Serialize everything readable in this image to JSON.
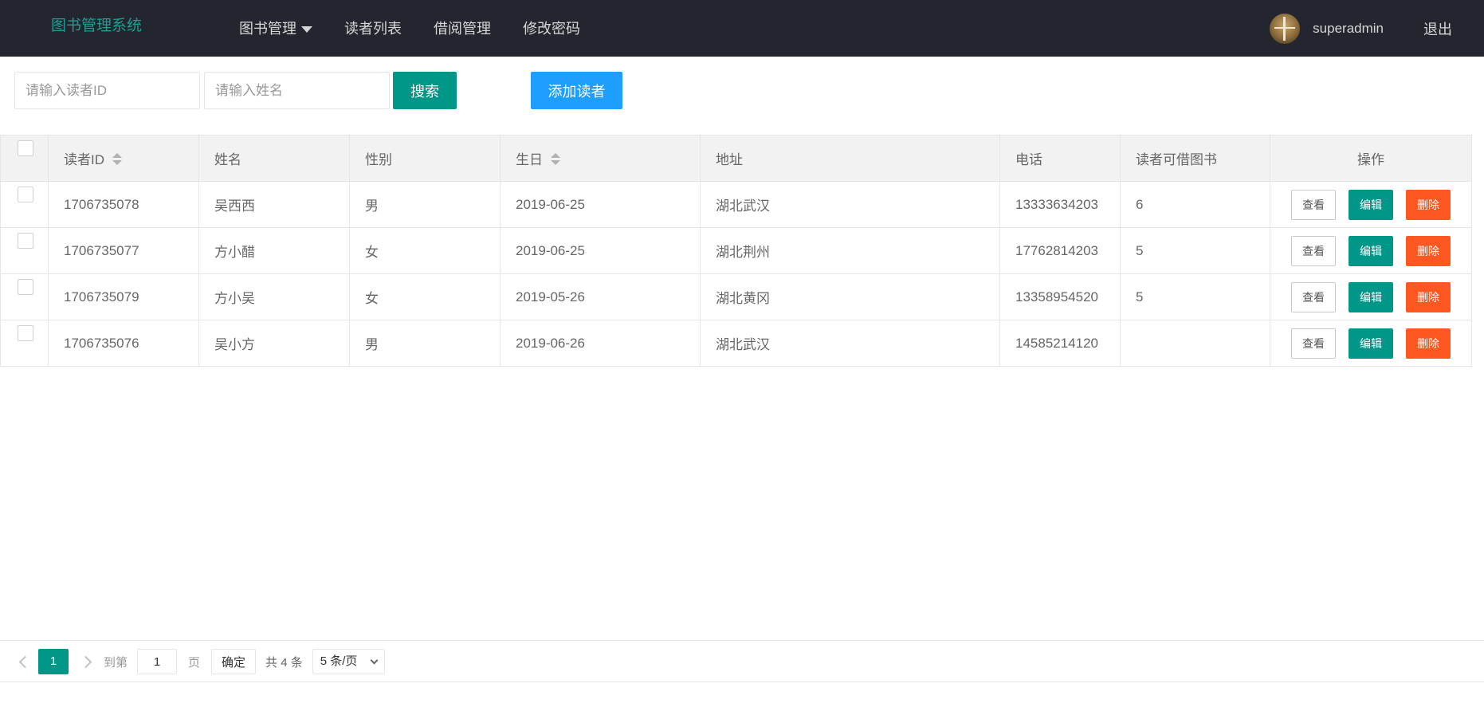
{
  "header": {
    "logo": "图书管理系统",
    "nav": [
      {
        "label": "图书管理",
        "has_dropdown": true,
        "icon": "caret-down-icon"
      },
      {
        "label": "读者列表"
      },
      {
        "label": "借阅管理"
      },
      {
        "label": "修改密码"
      }
    ],
    "username": "superadmin",
    "logout": "退出"
  },
  "toolbar": {
    "reader_id_placeholder": "请输入读者ID",
    "name_placeholder": "请输入姓名",
    "search_label": "搜索",
    "add_label": "添加读者"
  },
  "table": {
    "columns": [
      "读者ID",
      "姓名",
      "性别",
      "生日",
      "地址",
      "电话",
      "读者可借图书",
      "操作"
    ],
    "sortable": [
      "读者ID",
      "生日"
    ],
    "rows": [
      {
        "id": "1706735078",
        "name": "吴西西",
        "gender": "男",
        "birthday": "2019-06-25",
        "address": "湖北武汉",
        "phone": "13333634203",
        "quota": "6"
      },
      {
        "id": "1706735077",
        "name": "方小醋",
        "gender": "女",
        "birthday": "2019-06-25",
        "address": "湖北荆州",
        "phone": "17762814203",
        "quota": "5"
      },
      {
        "id": "1706735079",
        "name": "方小吴",
        "gender": "女",
        "birthday": "2019-05-26",
        "address": "湖北黄冈",
        "phone": "13358954520",
        "quota": "5"
      },
      {
        "id": "1706735076",
        "name": "吴小方",
        "gender": "男",
        "birthday": "2019-06-26",
        "address": "湖北武汉",
        "phone": "14585214120",
        "quota": ""
      }
    ],
    "actions": {
      "view": "查看",
      "edit": "编辑",
      "delete": "删除"
    }
  },
  "pagination": {
    "current_page": "1",
    "goto_label": "到第",
    "goto_value": "1",
    "page_unit": "页",
    "confirm": "确定",
    "total": "共 4 条",
    "page_size": "5 条/页"
  },
  "colors": {
    "header_bg": "#23262e",
    "logo": "#1aa094",
    "primary": "#009688",
    "normal": "#1e9fff",
    "danger": "#ff5722"
  }
}
